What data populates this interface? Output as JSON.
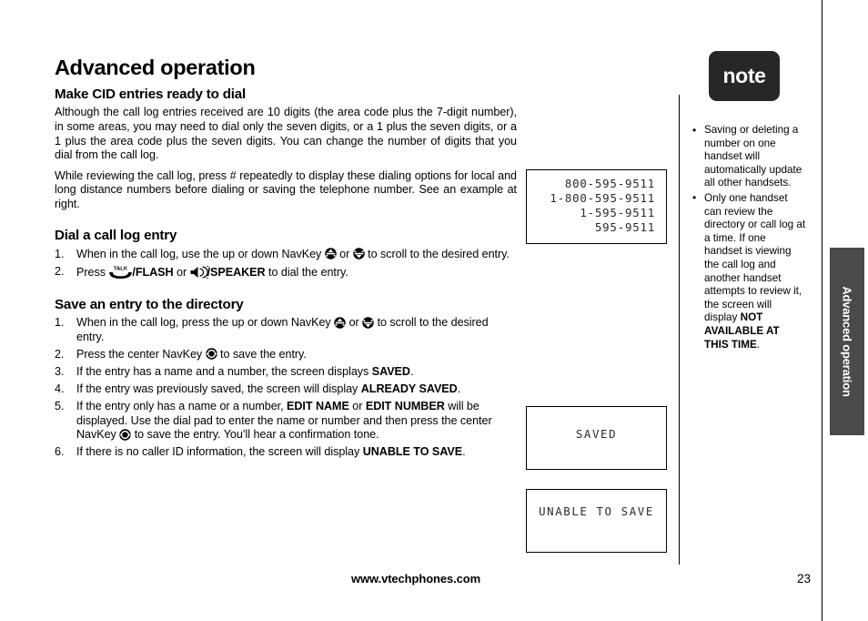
{
  "document": {
    "page_title": "Advanced operation",
    "page_number": "23",
    "footer_url": "www.vtechphones.com",
    "edge_tab_label": "Advanced operation"
  },
  "sections": [
    {
      "heading": "Make CID entries ready to dial",
      "paragraphs": [
        "Although the call log entries received are 10 digits (the area code plus the 7-digit number),  in some areas, you may need to dial only the seven digits, or a 1 plus the seven digits,  or a 1 plus the area code plus the seven digits. You can change the number of digits that you dial from the call log.",
        "While reviewing the call log, press # repeatedly to display these dialing options for local and long distance numbers before dialing or saving the telephone number.  See an example at right."
      ]
    },
    {
      "heading": "Dial a call log entry",
      "steps": [
        {
          "num": "1.",
          "parts": [
            {
              "type": "text",
              "value": "When in the call log, use the up or down NavKey "
            },
            {
              "type": "icon",
              "value": "navkey-up-icon"
            },
            {
              "type": "text",
              "value": " or "
            },
            {
              "type": "icon",
              "value": "navkey-down-icon"
            },
            {
              "type": "text",
              "value": " to scroll to the desired entry."
            }
          ]
        },
        {
          "num": "2.",
          "parts": [
            {
              "type": "text",
              "value": "Press "
            },
            {
              "type": "icon",
              "value": "talk-handset-icon"
            },
            {
              "type": "bold",
              "value": "/FLASH"
            },
            {
              "type": "text",
              "value": " or "
            },
            {
              "type": "icon",
              "value": "speaker-icon"
            },
            {
              "type": "bold",
              "value": "/SPEAKER"
            },
            {
              "type": "text",
              "value": " to dial the entry."
            }
          ]
        }
      ]
    },
    {
      "heading": "Save an entry to the directory",
      "steps": [
        {
          "num": "1.",
          "parts": [
            {
              "type": "text",
              "value": "When in the call log, press the up or down NavKey "
            },
            {
              "type": "icon",
              "value": "navkey-up-icon"
            },
            {
              "type": "text",
              "value": " or "
            },
            {
              "type": "icon",
              "value": "navkey-down-icon"
            },
            {
              "type": "text",
              "value": " to scroll to the desired entry."
            }
          ]
        },
        {
          "num": "2.",
          "parts": [
            {
              "type": "text",
              "value": "Press the center NavKey "
            },
            {
              "type": "icon",
              "value": "navkey-center-icon"
            },
            {
              "type": "text",
              "value": " to save the entry."
            }
          ]
        },
        {
          "num": "3.",
          "parts": [
            {
              "type": "text",
              "value": "If the entry has a name and a number, the screen displays "
            },
            {
              "type": "bold",
              "value": "SAVED"
            },
            {
              "type": "text",
              "value": "."
            }
          ]
        },
        {
          "num": "4.",
          "parts": [
            {
              "type": "text",
              "value": "If the entry was previously saved, the screen will display "
            },
            {
              "type": "bold",
              "value": "ALREADY SAVED"
            },
            {
              "type": "text",
              "value": "."
            }
          ]
        },
        {
          "num": "5.",
          "parts": [
            {
              "type": "text",
              "value": "If the entry only has a name or a number, "
            },
            {
              "type": "bold",
              "value": "EDIT NAME"
            },
            {
              "type": "text",
              "value": " or "
            },
            {
              "type": "bold",
              "value": "EDIT NUMBER"
            },
            {
              "type": "text",
              "value": " will be displayed. Use the dial pad to enter the name or number and then press the center NavKey "
            },
            {
              "type": "icon",
              "value": "navkey-center-icon"
            },
            {
              "type": "text",
              "value": " to save the entry. You’ll hear a confirmation tone."
            }
          ]
        },
        {
          "num": "6.",
          "parts": [
            {
              "type": "text",
              "value": "If there is no caller ID information, the screen will display "
            },
            {
              "type": "bold",
              "value": "UNABLE TO SAVE"
            },
            {
              "type": "text",
              "value": "."
            }
          ]
        }
      ]
    }
  ],
  "lcd_screens": {
    "dial_options": {
      "name": "dialing-options-display",
      "lines": [
        "800-595-9511",
        "1-800-595-9511",
        "1-595-9511",
        "595-9511"
      ]
    },
    "saved": {
      "name": "saved-display",
      "text": "SAVED"
    },
    "unable_to_save": {
      "name": "unable-to-save-display",
      "text": "UNABLE TO SAVE"
    }
  },
  "note": {
    "badge_label": "note",
    "bullets": [
      {
        "parts": [
          {
            "type": "text",
            "value": "Saving or deleting a number on one handset will automatically update all other handsets."
          }
        ]
      },
      {
        "parts": [
          {
            "type": "text",
            "value": "Only one handset can review the directory or call log at a time. If one handset is viewing the call log and another handset attempts to review it, the screen will display "
          },
          {
            "type": "bold",
            "value": "NOT AVAILABLE AT THIS TIME"
          },
          {
            "type": "text",
            "value": "."
          }
        ]
      }
    ]
  },
  "colors": {
    "text": "#000000",
    "note_badge_bg": "#272727",
    "edge_tab_bg": "#4a4a4a",
    "lcd_text": "#2b2b2b"
  }
}
